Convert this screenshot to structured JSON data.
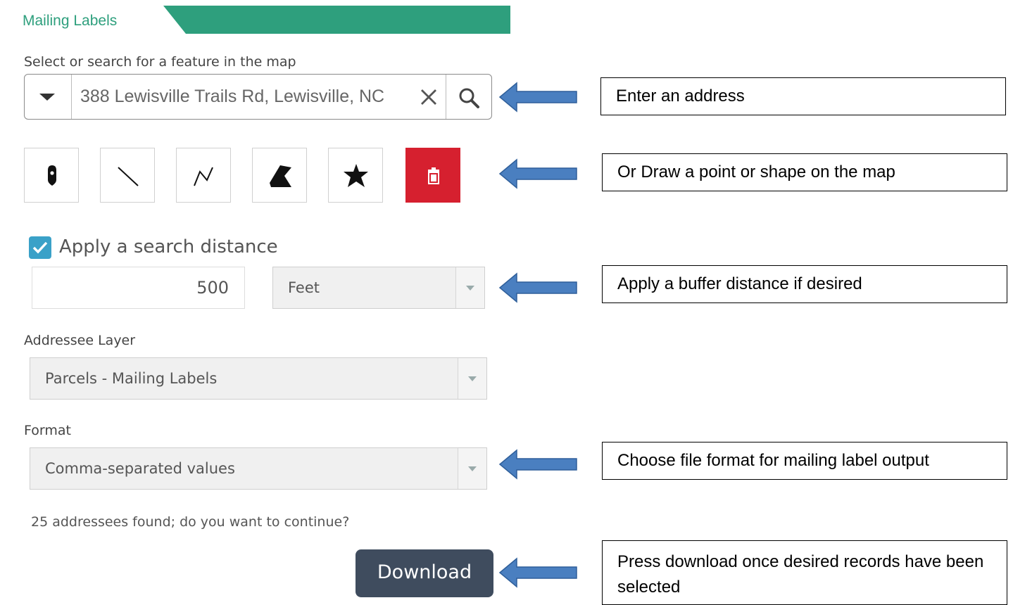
{
  "header": {
    "title": "Mailing Labels",
    "accent_color": "#2e9f7d"
  },
  "search": {
    "prompt": "Select or search for a feature in the map",
    "value": "388 Lewisville Trails Rd, Lewisville, NC",
    "dropdown_icon": "caret-down-icon",
    "clear_icon": "close-icon",
    "search_icon": "search-icon"
  },
  "draw_tools": [
    {
      "name": "point",
      "icon": "map-pin-icon"
    },
    {
      "name": "line",
      "icon": "line-icon"
    },
    {
      "name": "polyline",
      "icon": "polyline-icon"
    },
    {
      "name": "polygon",
      "icon": "polygon-icon"
    },
    {
      "name": "freehand",
      "icon": "freehand-polygon-icon"
    },
    {
      "name": "clear",
      "icon": "trash-icon",
      "color": "#d6202f"
    }
  ],
  "distance": {
    "checkbox_label": "Apply a search distance",
    "checked": true,
    "value": "500",
    "unit": "Feet",
    "check_color": "#3aa1c8"
  },
  "addressee": {
    "label": "Addressee Layer",
    "value": "Parcels - Mailing Labels"
  },
  "format": {
    "label": "Format",
    "value": "Comma-separated values"
  },
  "status": {
    "message": "25 addressees found; do you want to continue?"
  },
  "download": {
    "label": "Download",
    "color": "#3f4c5e"
  },
  "callouts": {
    "address": "Enter an address",
    "draw": "Or Draw a point or shape on the map",
    "buffer": "Apply a buffer distance if desired",
    "format": "Choose file format for mailing label output",
    "download": "Press download once desired records have been selected",
    "arrow_color": "#4a7fc0"
  }
}
